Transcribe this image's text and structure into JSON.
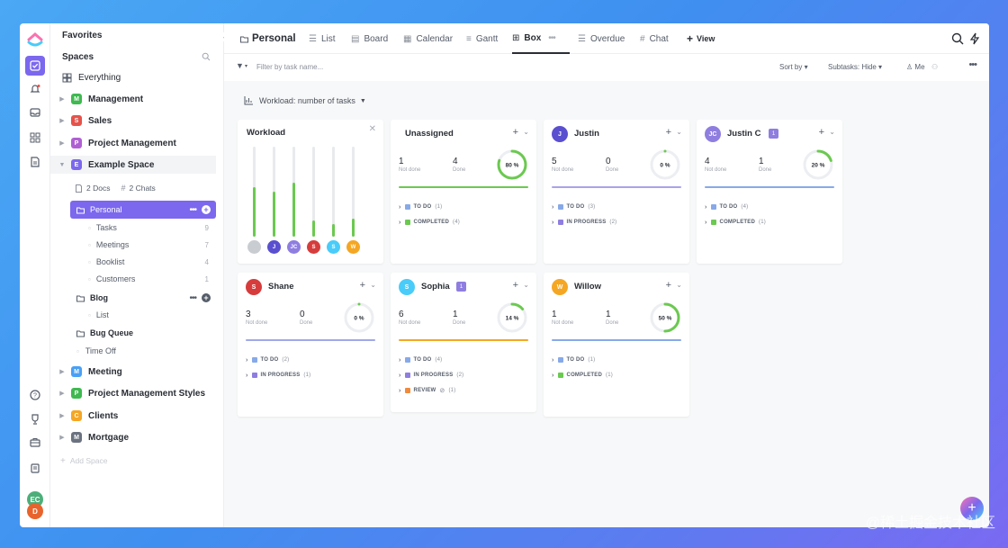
{
  "sidebar": {
    "favorites": "Favorites",
    "spaces": "Spaces",
    "everything": "Everything",
    "spaces_list": [
      {
        "letter": "M",
        "label": "Management",
        "color": "#3fb950"
      },
      {
        "letter": "S",
        "label": "Sales",
        "color": "#e5534b"
      },
      {
        "letter": "P",
        "label": "Project Management",
        "color": "#b05fd3"
      },
      {
        "letter": "E",
        "label": "Example Space",
        "color": "#7b68ee"
      }
    ],
    "docs": "2 Docs",
    "chats": "2 Chats",
    "personal": "Personal",
    "personal_lists": [
      {
        "label": "Tasks",
        "count": "9"
      },
      {
        "label": "Meetings",
        "count": "7"
      },
      {
        "label": "Booklist",
        "count": "4"
      },
      {
        "label": "Customers",
        "count": "1"
      }
    ],
    "blog": "Blog",
    "blog_list": "List",
    "bug_queue": "Bug Queue",
    "time_off": "Time Off",
    "more_spaces": [
      {
        "letter": "M",
        "label": "Meeting",
        "color": "#49a0f5"
      },
      {
        "letter": "P",
        "label": "Project Management Styles",
        "color": "#3fb950"
      },
      {
        "letter": "C",
        "label": "Clients",
        "color": "#f5a623"
      },
      {
        "letter": "M",
        "label": "Mortgage",
        "color": "#6b7280"
      }
    ],
    "add_space": "Add Space",
    "user_initials": "EC",
    "user2_initial": "D"
  },
  "header": {
    "title": "Personal",
    "tabs": [
      "List",
      "Board",
      "Calendar",
      "Gantt",
      "Box",
      "Overdue",
      "Chat"
    ],
    "view_btn": "View"
  },
  "filterbar": {
    "placeholder": "Filter by task name...",
    "sort": "Sort by",
    "subtasks": "Subtasks: Hide",
    "me": "Me"
  },
  "workload_btn": "Workload: number of tasks",
  "workload_panel": {
    "title": "Workload",
    "bars": [
      {
        "initials": "",
        "color": "#c9ccd1",
        "fill": 0.55
      },
      {
        "initials": "J",
        "color": "#5a4fcf",
        "fill": 0.5
      },
      {
        "initials": "JC",
        "color": "#8f7ee0",
        "fill": 0.6
      },
      {
        "initials": "S",
        "color": "#d63c3c",
        "fill": 0.18
      },
      {
        "initials": "S",
        "color": "#49ccf9",
        "fill": 0.14
      },
      {
        "initials": "W",
        "color": "#f5a623",
        "fill": 0.2
      }
    ]
  },
  "cards": [
    {
      "name": "Unassigned",
      "initials": "",
      "avatar_color": "",
      "badge": "",
      "not_done": "1",
      "done": "4",
      "not_done_label": "Not done",
      "done_label": "Done",
      "pct": "80 %",
      "pct_value": 0.8,
      "bar_color": "#6bc950",
      "groups": [
        {
          "label": "TO DO",
          "count": "(1)",
          "color": "#87a9e8"
        },
        {
          "label": "COMPLETED",
          "count": "(4)",
          "color": "#6bc950"
        }
      ]
    },
    {
      "name": "Justin",
      "initials": "J",
      "avatar_color": "#5a4fcf",
      "badge": "",
      "not_done": "5",
      "done": "0",
      "not_done_label": "Not done",
      "done_label": "Done",
      "pct": "0 %",
      "pct_value": 0,
      "bar_color": "#a9a3e8",
      "groups": [
        {
          "label": "TO DO",
          "count": "(3)",
          "color": "#87a9e8"
        },
        {
          "label": "IN PROGRESS",
          "count": "(2)",
          "color": "#8f7ee0"
        }
      ]
    },
    {
      "name": "Justin C",
      "initials": "JC",
      "avatar_color": "#8f7ee0",
      "badge": "1",
      "not_done": "4",
      "done": "1",
      "not_done_label": "Not done",
      "done_label": "Done",
      "pct": "20 %",
      "pct_value": 0.2,
      "bar_color": "#87a9e8",
      "groups": [
        {
          "label": "TO DO",
          "count": "(4)",
          "color": "#87a9e8"
        },
        {
          "label": "COMPLETED",
          "count": "(1)",
          "color": "#6bc950"
        }
      ]
    },
    {
      "name": "Shane",
      "initials": "S",
      "avatar_color": "#d63c3c",
      "badge": "",
      "not_done": "3",
      "done": "0",
      "not_done_label": "Not done",
      "done_label": "Done",
      "pct": "0 %",
      "pct_value": 0,
      "bar_color": "#9fa8e8",
      "groups": [
        {
          "label": "TO DO",
          "count": "(2)",
          "color": "#87a9e8"
        },
        {
          "label": "IN PROGRESS",
          "count": "(1)",
          "color": "#8f7ee0"
        }
      ]
    },
    {
      "name": "Sophia",
      "initials": "S",
      "avatar_color": "#49ccf9",
      "badge": "1",
      "not_done": "6",
      "done": "1",
      "not_done_label": "Not done",
      "done_label": "Done",
      "pct": "14 %",
      "pct_value": 0.14,
      "bar_color": "#f5a623",
      "groups": [
        {
          "label": "TO DO",
          "count": "(4)",
          "color": "#87a9e8"
        },
        {
          "label": "IN PROGRESS",
          "count": "(2)",
          "color": "#8f7ee0"
        },
        {
          "label": "REVIEW",
          "count": "(1)",
          "color": "#f08a3c"
        }
      ]
    },
    {
      "name": "Willow",
      "initials": "W",
      "avatar_color": "#f5a623",
      "badge": "",
      "not_done": "1",
      "done": "1",
      "not_done_label": "Not done",
      "done_label": "Done",
      "pct": "50 %",
      "pct_value": 0.5,
      "bar_color": "#87a9e8",
      "groups": [
        {
          "label": "TO DO",
          "count": "(1)",
          "color": "#87a9e8"
        },
        {
          "label": "COMPLETED",
          "count": "(1)",
          "color": "#6bc950"
        }
      ]
    }
  ],
  "watermark": "@稀土掘金技术社区"
}
